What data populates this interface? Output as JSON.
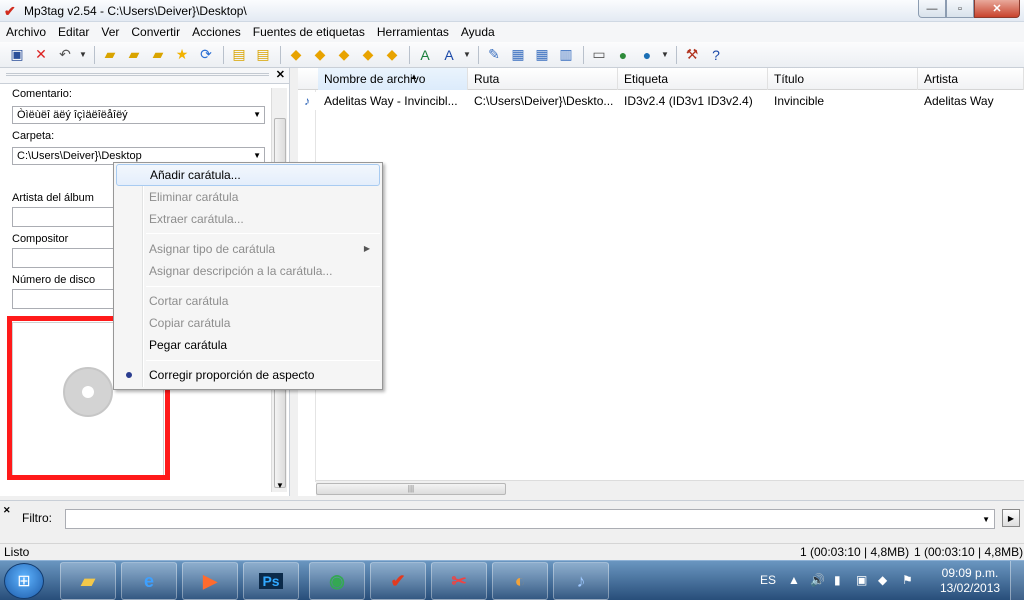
{
  "window": {
    "title": "Mp3tag v2.54  -  C:\\Users\\Deiver}\\Desktop\\",
    "controls": {
      "minimize": "—",
      "maximize": "▫",
      "close": "✕"
    }
  },
  "menu": [
    "Archivo",
    "Editar",
    "Ver",
    "Convertir",
    "Acciones",
    "Fuentes de etiquetas",
    "Herramientas",
    "Ayuda"
  ],
  "toolbar": {
    "icons": [
      "save-icon",
      "remove-icon",
      "undo-icon",
      "add-directory-icon",
      "add-directory-alt-icon",
      "open-folder-icon",
      "favorite-star-icon",
      "refresh-icon",
      "export-icon",
      "export-alt-icon",
      "tag-to-filename-icon",
      "filename-to-tag-icon",
      "text-file-to-tag-icon",
      "tag-to-tag-icon",
      "auto-numbering-icon",
      "replace-icon",
      "case-conversion-icon",
      "extended-tags-icon",
      "actions-icon",
      "quick-actions-icon",
      "numbering-wizard-icon",
      "print-icon",
      "web-icon",
      "freedb-icon",
      "options-icon",
      "help-icon"
    ]
  },
  "left_panel": {
    "comentario_label": "Comentario:",
    "comentario_value": "Òìëùëî äëý îçìäëîëåîëý",
    "carpeta_label": "Carpeta:",
    "carpeta_value": "C:\\Users\\Deiver}\\Desktop",
    "artista_album_label": "Artista del álbum",
    "compositor_label": "Compositor",
    "numero_disco_label": "Número de disco"
  },
  "file_list": {
    "columns": [
      "Nombre de archivo",
      "Ruta",
      "Etiqueta",
      "Título",
      "Artista"
    ],
    "rows": [
      {
        "nombre": "Adelitas Way - Invincibl...",
        "ruta": "C:\\Users\\Deiver}\\Deskto...",
        "etiqueta": "ID3v2.4 (ID3v1 ID3v2.4)",
        "titulo": "Invincible",
        "artista": "Adelitas Way"
      }
    ]
  },
  "context_menu": {
    "items": [
      {
        "label": "Añadir carátula...",
        "enabled": true
      },
      {
        "label": "Eliminar carátula",
        "enabled": false
      },
      {
        "label": "Extraer carátula...",
        "enabled": false
      },
      {
        "label": "Asignar tipo de carátula",
        "enabled": false
      },
      {
        "label": "Asignar descripción a la carátula...",
        "enabled": false
      },
      {
        "label": "Cortar carátula",
        "enabled": false
      },
      {
        "label": "Copiar carátula",
        "enabled": false
      },
      {
        "label": "Pegar carátula",
        "enabled": true
      },
      {
        "label": "Corregir proporción de aspecto",
        "enabled": true
      }
    ]
  },
  "filter": {
    "label": "Filtro:",
    "value": ""
  },
  "status": {
    "left": "Listo",
    "mid": "1 (00:03:10 | 4,8MB)",
    "right": "1 (00:03:10 | 4,8MB)"
  },
  "taskbar": {
    "apps": [
      "explorer-icon",
      "internet-explorer-icon",
      "media-player-icon",
      "photoshop-icon",
      "chrome-icon",
      "mp3tag-icon",
      "paint-icon",
      "paint-alt-icon",
      "itunes-icon"
    ],
    "photoshop_label": "Ps",
    "lang": "ES",
    "time": "09:09 p.m.",
    "date": "13/02/2013"
  },
  "colors": {
    "highlight_border": "#ff1a1a",
    "taskbar": "#284e7a"
  }
}
